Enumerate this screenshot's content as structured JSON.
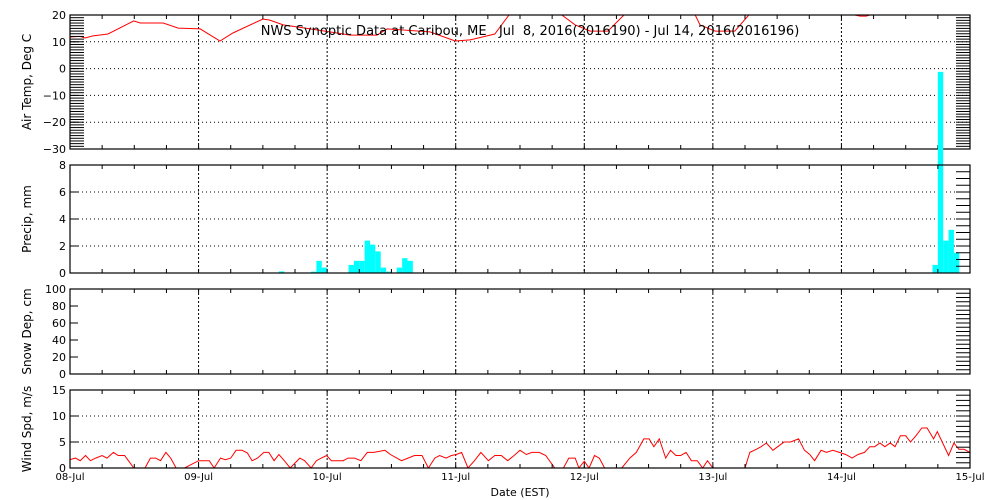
{
  "chart_data": {
    "type": "line",
    "title": "NWS Synoptic Data at Caribou, ME   Jul  8, 2016(2016190) - Jul 14, 2016(2016196)",
    "xlabel": "Date (EST)",
    "x_units": "hours since 08-Jul 00:00 EST",
    "xlim": [
      0,
      168
    ],
    "x_tick_labels": [
      "08-Jul",
      "09-Jul",
      "10-Jul",
      "11-Jul",
      "12-Jul",
      "13-Jul",
      "14-Jul",
      "15-Jul"
    ],
    "grid": true,
    "colors": {
      "temp": "#ff0000",
      "precip": "#00ffff",
      "wind": "#ff0000",
      "axis": "#000000"
    },
    "panels": [
      {
        "id": "temp",
        "ylabel": "Air Temp, Deg C",
        "type": "line",
        "ylim": [
          -30,
          20
        ],
        "y_ticks": [
          -30,
          -20,
          -10,
          0,
          10,
          20
        ],
        "series": [
          [
            0,
            11.8
          ],
          [
            1.9,
            12
          ],
          [
            2.8,
            11.4
          ],
          [
            4.3,
            12.2
          ],
          [
            7.1,
            12.9
          ],
          [
            11.9,
            17.8
          ],
          [
            13.1,
            17
          ],
          [
            17.4,
            17
          ],
          [
            20.2,
            15.1
          ],
          [
            24.3,
            14.8
          ],
          [
            28,
            10.3
          ],
          [
            30.4,
            13.3
          ],
          [
            36,
            18.5
          ],
          [
            37.3,
            18.1
          ],
          [
            39.8,
            16.3
          ],
          [
            43.9,
            15.1
          ],
          [
            48.5,
            13.7
          ],
          [
            52.3,
            12.5
          ],
          [
            57.3,
            12.5
          ],
          [
            59.2,
            14.8
          ],
          [
            67.2,
            13.7
          ],
          [
            71.9,
            10.3
          ],
          [
            74.7,
            10.7
          ],
          [
            79.3,
            12.9
          ],
          [
            82.1,
            20.4
          ],
          [
            87,
            24
          ],
          [
            91.8,
            20
          ],
          [
            94.3,
            16.3
          ],
          [
            97.1,
            14
          ],
          [
            100.4,
            14
          ],
          [
            103.6,
            20.4
          ],
          [
            110,
            24
          ],
          [
            116.7,
            20
          ],
          [
            117.6,
            16.3
          ],
          [
            120.4,
            14
          ],
          [
            124.1,
            14
          ],
          [
            126.9,
            20.4
          ],
          [
            136,
            26
          ],
          [
            146.5,
            20
          ],
          [
            147.5,
            19.6
          ],
          [
            148.6,
            19.6
          ],
          [
            149.3,
            20
          ],
          [
            158.7,
            25
          ],
          [
            168,
            23
          ]
        ]
      },
      {
        "id": "precip",
        "ylabel": "Precip, mm",
        "type": "bar",
        "bar_width_hours": 1,
        "ylim": [
          0,
          8
        ],
        "y_ticks": [
          0,
          2,
          4,
          6,
          8
        ],
        "series": [
          [
            39,
            0.12
          ],
          [
            45,
            0.1
          ],
          [
            46,
            0.9
          ],
          [
            47,
            0.4
          ],
          [
            52,
            0.6
          ],
          [
            53,
            0.9
          ],
          [
            54,
            0.9
          ],
          [
            55,
            2.4
          ],
          [
            56,
            2.1
          ],
          [
            57,
            1.6
          ],
          [
            58,
            0.4
          ],
          [
            59,
            0.1
          ],
          [
            61,
            0.4
          ],
          [
            62,
            1.1
          ],
          [
            63,
            0.9
          ],
          [
            161,
            0.6
          ],
          [
            162,
            14.9
          ],
          [
            163,
            2.4
          ],
          [
            164,
            3.2
          ],
          [
            165,
            1.5
          ]
        ]
      },
      {
        "id": "snow",
        "ylabel": "Snow Dep, cm",
        "type": "line",
        "ylim": [
          0,
          100
        ],
        "y_ticks": [
          0,
          20,
          40,
          60,
          80,
          100
        ],
        "series": []
      },
      {
        "id": "wind",
        "ylabel": "Wind Spd, m/s",
        "type": "line",
        "ylim": [
          0,
          15
        ],
        "y_ticks": [
          0,
          5,
          10,
          15
        ],
        "series": [
          [
            0,
            1.6
          ],
          [
            1,
            1.9
          ],
          [
            1.9,
            1.4
          ],
          [
            2.9,
            2.4
          ],
          [
            3.8,
            1.4
          ],
          [
            4.8,
            1.9
          ],
          [
            6,
            2.4
          ],
          [
            6.9,
            1.9
          ],
          [
            8.1,
            3
          ],
          [
            9,
            2.4
          ],
          [
            10.2,
            2.4
          ],
          [
            11.9,
            0
          ],
          [
            14,
            0
          ],
          [
            15,
            1.9
          ],
          [
            16,
            1.9
          ],
          [
            16.9,
            1.4
          ],
          [
            17.9,
            3
          ],
          [
            18.8,
            1.9
          ],
          [
            19.8,
            0
          ],
          [
            21.4,
            0
          ],
          [
            24,
            1.4
          ],
          [
            25,
            1.4
          ],
          [
            26,
            1.4
          ],
          [
            26.9,
            0
          ],
          [
            28.1,
            1.9
          ],
          [
            29,
            1.6
          ],
          [
            30,
            1.9
          ],
          [
            31,
            3.4
          ],
          [
            32.1,
            3.4
          ],
          [
            33.1,
            2.9
          ],
          [
            34,
            1.4
          ],
          [
            35,
            1.9
          ],
          [
            36.2,
            3
          ],
          [
            37.1,
            3
          ],
          [
            38.1,
            1.4
          ],
          [
            39,
            2.6
          ],
          [
            40,
            1.4
          ],
          [
            41.1,
            0
          ],
          [
            42.9,
            1.9
          ],
          [
            43.8,
            1.4
          ],
          [
            45,
            0
          ],
          [
            46,
            1.4
          ],
          [
            46.9,
            1.9
          ],
          [
            47.9,
            2.4
          ],
          [
            48.8,
            1.4
          ],
          [
            50,
            1.4
          ],
          [
            51,
            1.4
          ],
          [
            51.9,
            1.9
          ],
          [
            53.1,
            1.9
          ],
          [
            54.3,
            1.4
          ],
          [
            55.5,
            3
          ],
          [
            56.7,
            3
          ],
          [
            58.8,
            3.4
          ],
          [
            59.8,
            2.6
          ],
          [
            61,
            1.9
          ],
          [
            61.9,
            1.4
          ],
          [
            63.1,
            1.9
          ],
          [
            64.3,
            2.4
          ],
          [
            65.7,
            2.4
          ],
          [
            66.9,
            0
          ],
          [
            68.1,
            1.9
          ],
          [
            69,
            2.4
          ],
          [
            70.2,
            1.9
          ],
          [
            71.2,
            2.4
          ],
          [
            72.1,
            2.6
          ],
          [
            73.1,
            3
          ],
          [
            74.3,
            0
          ],
          [
            75.5,
            1.4
          ],
          [
            76.7,
            3
          ],
          [
            78.1,
            1.4
          ],
          [
            79.3,
            2.4
          ],
          [
            80.5,
            2.4
          ],
          [
            81.7,
            1.4
          ],
          [
            82.9,
            2.4
          ],
          [
            84,
            3.4
          ],
          [
            85.2,
            2.6
          ],
          [
            86.2,
            3
          ],
          [
            87.6,
            3
          ],
          [
            88.8,
            2.4
          ],
          [
            90.5,
            0
          ],
          [
            92.1,
            0
          ],
          [
            93.1,
            1.9
          ],
          [
            94.3,
            1.9
          ],
          [
            95,
            0
          ],
          [
            96,
            1.3
          ],
          [
            96.9,
            0
          ],
          [
            97.9,
            2.4
          ],
          [
            98.8,
            1.9
          ],
          [
            99.8,
            0
          ],
          [
            103,
            0
          ],
          [
            104.5,
            1.9
          ],
          [
            105.7,
            3
          ],
          [
            107.1,
            5.6
          ],
          [
            108.1,
            5.6
          ],
          [
            109,
            4.1
          ],
          [
            110,
            5.6
          ],
          [
            111.2,
            1.9
          ],
          [
            112.1,
            3.4
          ],
          [
            113.1,
            2.4
          ],
          [
            114,
            2.4
          ],
          [
            115,
            3
          ],
          [
            116,
            1.4
          ],
          [
            117.1,
            1.4
          ],
          [
            118.1,
            0
          ],
          [
            119,
            1.4
          ],
          [
            120,
            0
          ],
          [
            126,
            0
          ],
          [
            126.9,
            3
          ],
          [
            128.1,
            3.6
          ],
          [
            129,
            4.1
          ],
          [
            130,
            4.8
          ],
          [
            131.2,
            3.4
          ],
          [
            132.1,
            4.1
          ],
          [
            133.3,
            5
          ],
          [
            134.5,
            5
          ],
          [
            136,
            5.6
          ],
          [
            137.1,
            3.4
          ],
          [
            138.1,
            2.6
          ],
          [
            139,
            1.4
          ],
          [
            140.2,
            3.4
          ],
          [
            141.2,
            3
          ],
          [
            142.4,
            3.4
          ],
          [
            143.6,
            3
          ],
          [
            144.8,
            2.6
          ],
          [
            146,
            1.9
          ],
          [
            147.1,
            2.6
          ],
          [
            148.3,
            3
          ],
          [
            149.3,
            4.1
          ],
          [
            150.2,
            4.1
          ],
          [
            151.2,
            4.8
          ],
          [
            152.1,
            4.1
          ],
          [
            153.1,
            4.8
          ],
          [
            154,
            4.1
          ],
          [
            155,
            6.2
          ],
          [
            156,
            6.2
          ],
          [
            156.9,
            5
          ],
          [
            157.9,
            6.2
          ],
          [
            159,
            7.7
          ],
          [
            160,
            7.7
          ],
          [
            161.2,
            5.6
          ],
          [
            161.9,
            7
          ],
          [
            162.9,
            4.8
          ],
          [
            164,
            2.4
          ],
          [
            165,
            4.8
          ],
          [
            165.9,
            3.6
          ],
          [
            166.9,
            3.6
          ],
          [
            168,
            3
          ]
        ]
      }
    ]
  }
}
